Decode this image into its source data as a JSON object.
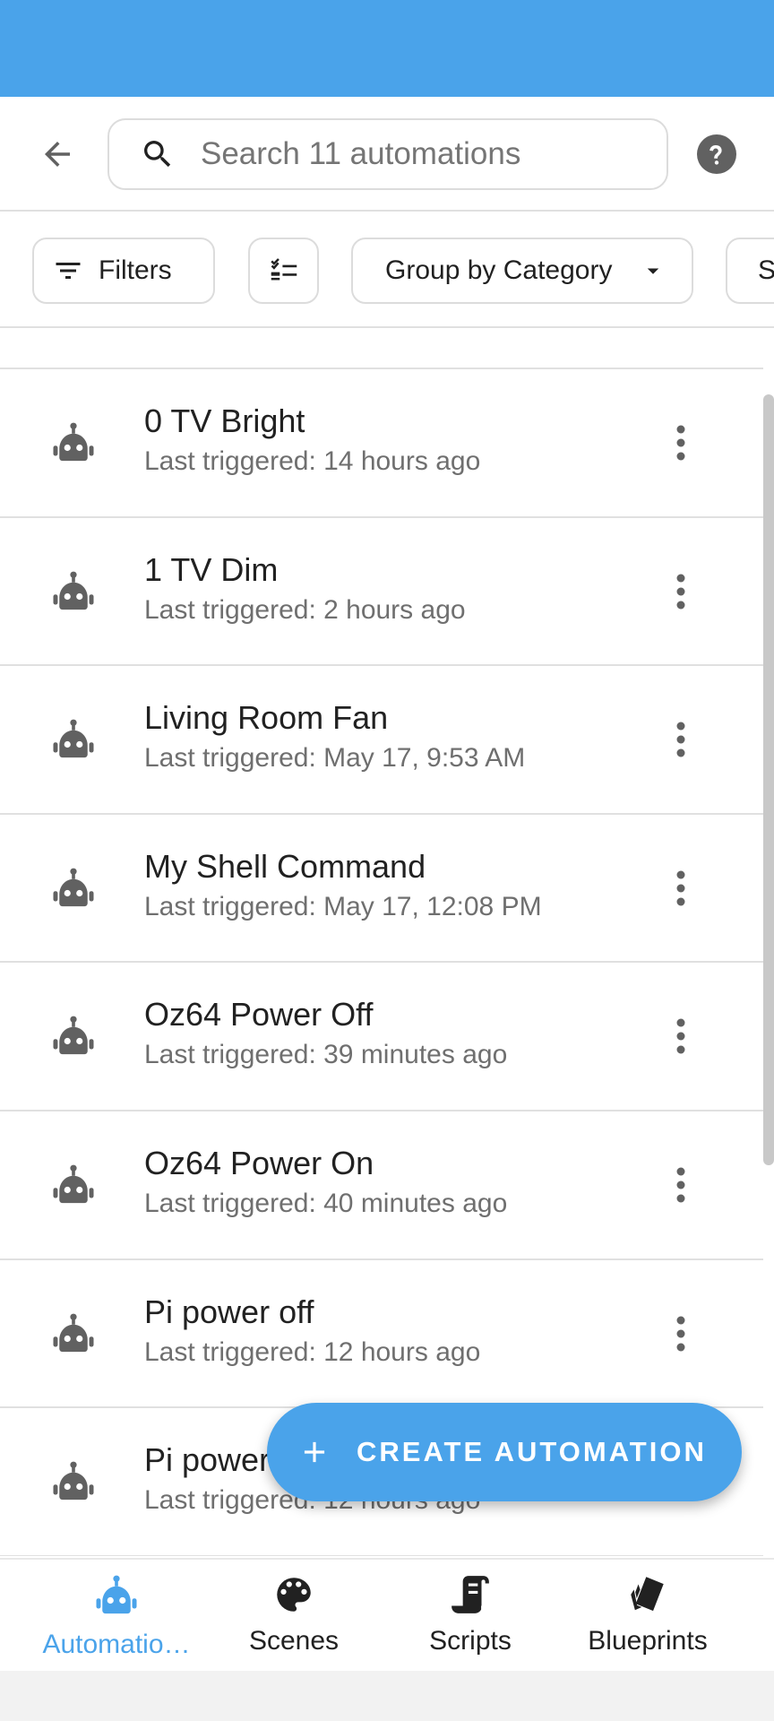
{
  "search": {
    "placeholder": "Search 11 automations"
  },
  "filters": {
    "filters_label": "Filters",
    "group_label": "Group by Category",
    "sort_label": "S"
  },
  "automations": [
    {
      "name": "0 TV Bright",
      "last_triggered": "Last triggered: 14 hours ago"
    },
    {
      "name": "1 TV Dim",
      "last_triggered": "Last triggered: 2 hours ago"
    },
    {
      "name": "Living Room Fan",
      "last_triggered": "Last triggered: May 17, 9:53 AM"
    },
    {
      "name": "My Shell Command",
      "last_triggered": "Last triggered: May 17, 12:08 PM"
    },
    {
      "name": "Oz64 Power Off",
      "last_triggered": "Last triggered: 39 minutes ago"
    },
    {
      "name": "Oz64 Power On",
      "last_triggered": "Last triggered: 40 minutes ago"
    },
    {
      "name": "Pi power off",
      "last_triggered": "Last triggered: 12 hours ago"
    },
    {
      "name": "Pi power on",
      "last_triggered": "Last triggered: 12 hours ago"
    }
  ],
  "fab": {
    "label": "CREATE AUTOMATION"
  },
  "nav": [
    {
      "label": "Automatio…",
      "icon": "robot-icon",
      "active": true
    },
    {
      "label": "Scenes",
      "icon": "palette-icon",
      "active": false
    },
    {
      "label": "Scripts",
      "icon": "script-icon",
      "active": false
    },
    {
      "label": "Blueprints",
      "icon": "blueprint-icon",
      "active": false
    }
  ],
  "colors": {
    "accent": "#4aa3ea",
    "icon": "#616161",
    "text": "#212121",
    "secondary": "#6f6f6f"
  }
}
